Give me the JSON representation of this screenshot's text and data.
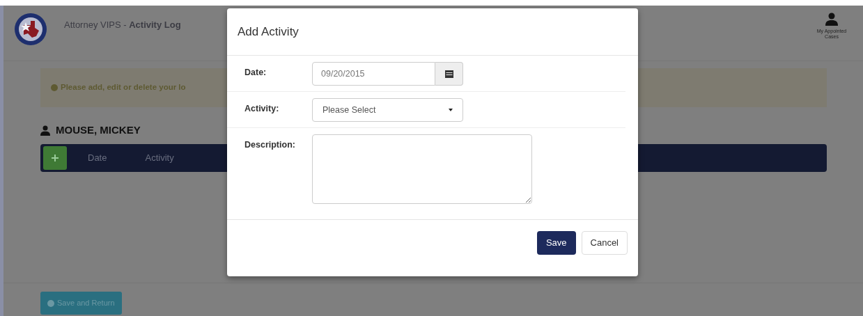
{
  "header": {
    "title": "Attorney VIPS - **Activity Log**",
    "user_menu": "My Appointed Cases"
  },
  "alert": {
    "text": "Please add, edit or delete your lo"
  },
  "client": {
    "name": "MOUSE, MICKEY"
  },
  "table": {
    "columns": [
      "Date",
      "Activity"
    ]
  },
  "footer": {
    "button": "Save and Return"
  },
  "modal": {
    "title": "Add Activity",
    "fields": [
      {
        "kind": "date",
        "label": "Date:",
        "value": "09/20/2015"
      },
      {
        "kind": "select",
        "label": "Activity:",
        "value": "Please Select"
      },
      {
        "kind": "textarea",
        "label": "Description:"
      }
    ],
    "buttons": [
      {
        "kind": "primary",
        "label": "Save"
      },
      {
        "kind": "secondary",
        "label": "Cancel"
      }
    ]
  }
}
